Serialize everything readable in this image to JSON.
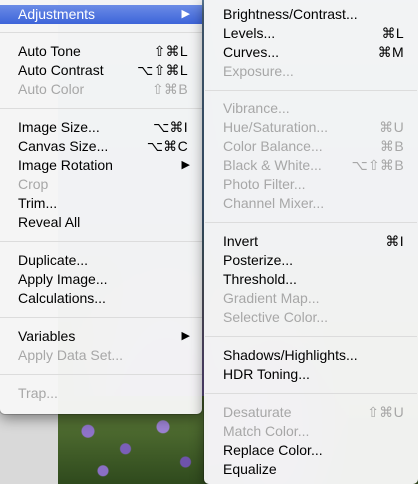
{
  "main_menu": {
    "items": [
      {
        "label": "Adjustments",
        "shortcut": "",
        "submenu": true,
        "enabled": true,
        "highlight": true
      },
      {
        "label": "Auto Tone",
        "shortcut": "⇧⌘L",
        "submenu": false,
        "enabled": true
      },
      {
        "label": "Auto Contrast",
        "shortcut": "⌥⇧⌘L",
        "submenu": false,
        "enabled": true
      },
      {
        "label": "Auto Color",
        "shortcut": "⇧⌘B",
        "submenu": false,
        "enabled": false
      },
      {
        "label": "Image Size...",
        "shortcut": "⌥⌘I",
        "submenu": false,
        "enabled": true
      },
      {
        "label": "Canvas Size...",
        "shortcut": "⌥⌘C",
        "submenu": false,
        "enabled": true
      },
      {
        "label": "Image Rotation",
        "shortcut": "",
        "submenu": true,
        "enabled": true
      },
      {
        "label": "Crop",
        "shortcut": "",
        "submenu": false,
        "enabled": false
      },
      {
        "label": "Trim...",
        "shortcut": "",
        "submenu": false,
        "enabled": true
      },
      {
        "label": "Reveal All",
        "shortcut": "",
        "submenu": false,
        "enabled": true
      },
      {
        "label": "Duplicate...",
        "shortcut": "",
        "submenu": false,
        "enabled": true
      },
      {
        "label": "Apply Image...",
        "shortcut": "",
        "submenu": false,
        "enabled": true
      },
      {
        "label": "Calculations...",
        "shortcut": "",
        "submenu": false,
        "enabled": true
      },
      {
        "label": "Variables",
        "shortcut": "",
        "submenu": true,
        "enabled": true
      },
      {
        "label": "Apply Data Set...",
        "shortcut": "",
        "submenu": false,
        "enabled": false
      },
      {
        "label": "Trap...",
        "shortcut": "",
        "submenu": false,
        "enabled": false
      }
    ],
    "submenu_arrow": "▶"
  },
  "adjustments_submenu": {
    "items": [
      {
        "label": "Brightness/Contrast...",
        "shortcut": "",
        "enabled": true
      },
      {
        "label": "Levels...",
        "shortcut": "⌘L",
        "enabled": true
      },
      {
        "label": "Curves...",
        "shortcut": "⌘M",
        "enabled": true
      },
      {
        "label": "Exposure...",
        "shortcut": "",
        "enabled": false
      },
      {
        "label": "Vibrance...",
        "shortcut": "",
        "enabled": false
      },
      {
        "label": "Hue/Saturation...",
        "shortcut": "⌘U",
        "enabled": false
      },
      {
        "label": "Color Balance...",
        "shortcut": "⌘B",
        "enabled": false
      },
      {
        "label": "Black & White...",
        "shortcut": "⌥⇧⌘B",
        "enabled": false
      },
      {
        "label": "Photo Filter...",
        "shortcut": "",
        "enabled": false
      },
      {
        "label": "Channel Mixer...",
        "shortcut": "",
        "enabled": false
      },
      {
        "label": "Invert",
        "shortcut": "⌘I",
        "enabled": true
      },
      {
        "label": "Posterize...",
        "shortcut": "",
        "enabled": true
      },
      {
        "label": "Threshold...",
        "shortcut": "",
        "enabled": true
      },
      {
        "label": "Gradient Map...",
        "shortcut": "",
        "enabled": false
      },
      {
        "label": "Selective Color...",
        "shortcut": "",
        "enabled": false
      },
      {
        "label": "Shadows/Highlights...",
        "shortcut": "",
        "enabled": true
      },
      {
        "label": "HDR Toning...",
        "shortcut": "",
        "enabled": true
      },
      {
        "label": "Desaturate",
        "shortcut": "⇧⌘U",
        "enabled": false
      },
      {
        "label": "Match Color...",
        "shortcut": "",
        "enabled": false
      },
      {
        "label": "Replace Color...",
        "shortcut": "",
        "enabled": true
      },
      {
        "label": "Equalize",
        "shortcut": "",
        "enabled": true
      }
    ]
  },
  "colors": {
    "highlight": "#3d64d9",
    "disabled_text": "#a7a7a7",
    "menu_bg": "#f6f6f6"
  }
}
